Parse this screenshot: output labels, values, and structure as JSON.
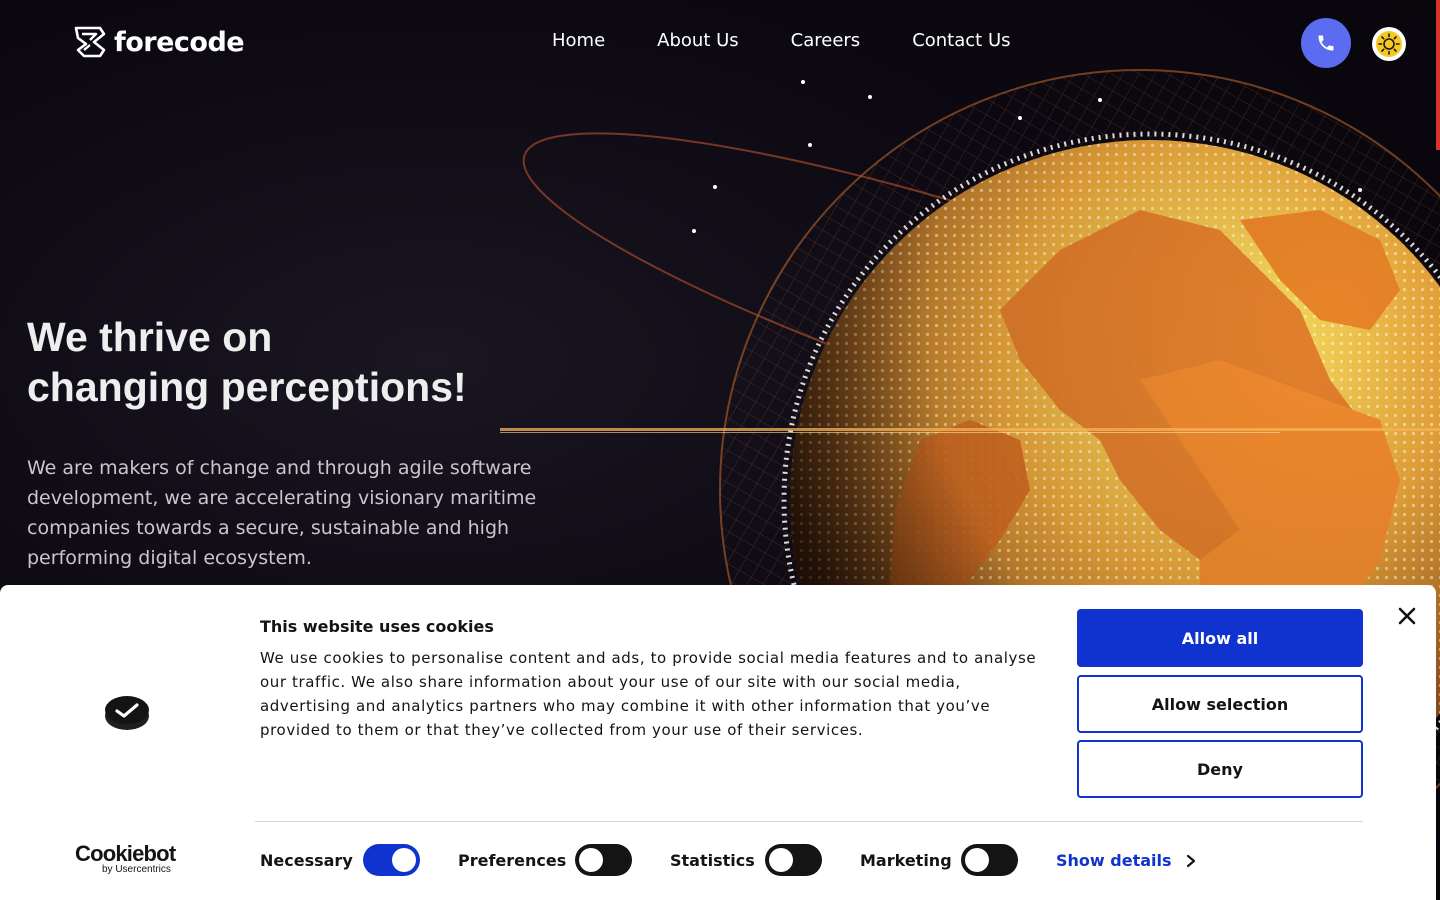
{
  "brand": {
    "name": "forecode"
  },
  "nav": {
    "items": [
      {
        "label": "Home"
      },
      {
        "label": "About Us"
      },
      {
        "label": "Careers"
      },
      {
        "label": "Contact Us"
      }
    ],
    "phone_icon": "phone-icon",
    "theme_icon": "sun-icon"
  },
  "hero": {
    "title_line1": "We thrive on",
    "title_line2": "changing perceptions!",
    "description": "We are makers of change and through agile software development, we are accelerating visionary maritime companies towards a secure, sustainable and high performing digital ecosystem."
  },
  "cookie_banner": {
    "title": "This website uses cookies",
    "description": "We use cookies to personalise content and ads, to provide social media features and to analyse our traffic. We also share information about your use of our site with our social media, advertising and analytics partners who may combine it with other information that you’ve provided to them or that they’ve collected from your use of their services.",
    "provider": "Cookiebot",
    "provider_sub": "by Usercentrics",
    "buttons": {
      "allow_all": "Allow all",
      "allow_selection": "Allow selection",
      "deny": "Deny"
    },
    "consents": [
      {
        "label": "Necessary",
        "checked": true
      },
      {
        "label": "Preferences",
        "checked": false
      },
      {
        "label": "Statistics",
        "checked": false
      },
      {
        "label": "Marketing",
        "checked": false
      }
    ],
    "show_details": "Show details"
  },
  "colors": {
    "accent_blue": "#1032cf",
    "phone_button": "#5b6cf0",
    "globe_orange": "#f0862a",
    "scroll_accent": "#d9342b"
  }
}
